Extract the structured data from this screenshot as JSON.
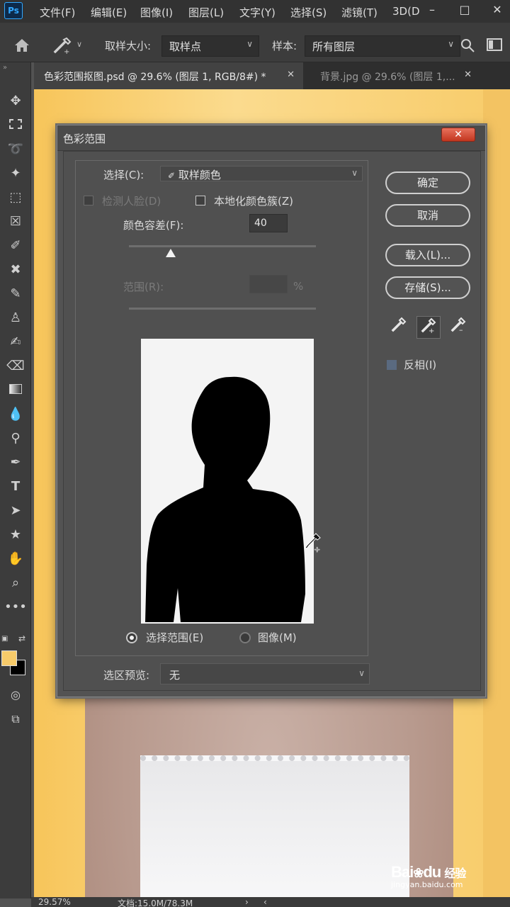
{
  "menubar": {
    "app_logo": "Ps",
    "items": [
      "文件(F)",
      "编辑(E)",
      "图像(I)",
      "图层(L)",
      "文字(Y)",
      "选择(S)",
      "滤镜(T)",
      "3D(D"
    ],
    "window_controls": [
      "–",
      "□",
      "✕"
    ]
  },
  "options_bar": {
    "sample_size_label": "取样大小:",
    "sample_size_value": "取样点",
    "sample_label": "样本:",
    "sample_value": "所有图层"
  },
  "tabs": [
    {
      "label": "色彩范围抠图.psd @ 29.6% (图层 1, RGB/8#) *",
      "active": true
    },
    {
      "label": "背景.jpg @ 29.6% (图层 1,...",
      "active": false
    }
  ],
  "colors": {
    "foreground": "#f7cb6a",
    "background": "#000000",
    "canvas_bg": "#f8cd6d"
  },
  "statusbar": {
    "zoom": "29.57%",
    "doc_info": "文档:15.0M/78.3M"
  },
  "dialog": {
    "title": "色彩范围",
    "close_symbol": "✕",
    "select_label": "选择(C):",
    "select_value": "取样颜色",
    "detect_faces_label": "检测人脸(D)",
    "localized_clusters_label": "本地化颜色簇(Z)",
    "fuzziness_label": "颜色容差(F):",
    "fuzziness_value": "40",
    "range_label": "范围(R):",
    "range_value": "",
    "range_unit": "%",
    "radio_selection_label": "选择范围(E)",
    "radio_image_label": "图像(M)",
    "selection_preview_label": "选区预览:",
    "selection_preview_value": "无",
    "ok_label": "确定",
    "cancel_label": "取消",
    "load_label": "载入(L)...",
    "save_label": "存储(S)...",
    "invert_label": "反相(I)"
  },
  "watermark": {
    "brand": "Bai",
    "brand2": "du",
    "cn": "经验",
    "url": "jingyan.baidu.com"
  }
}
